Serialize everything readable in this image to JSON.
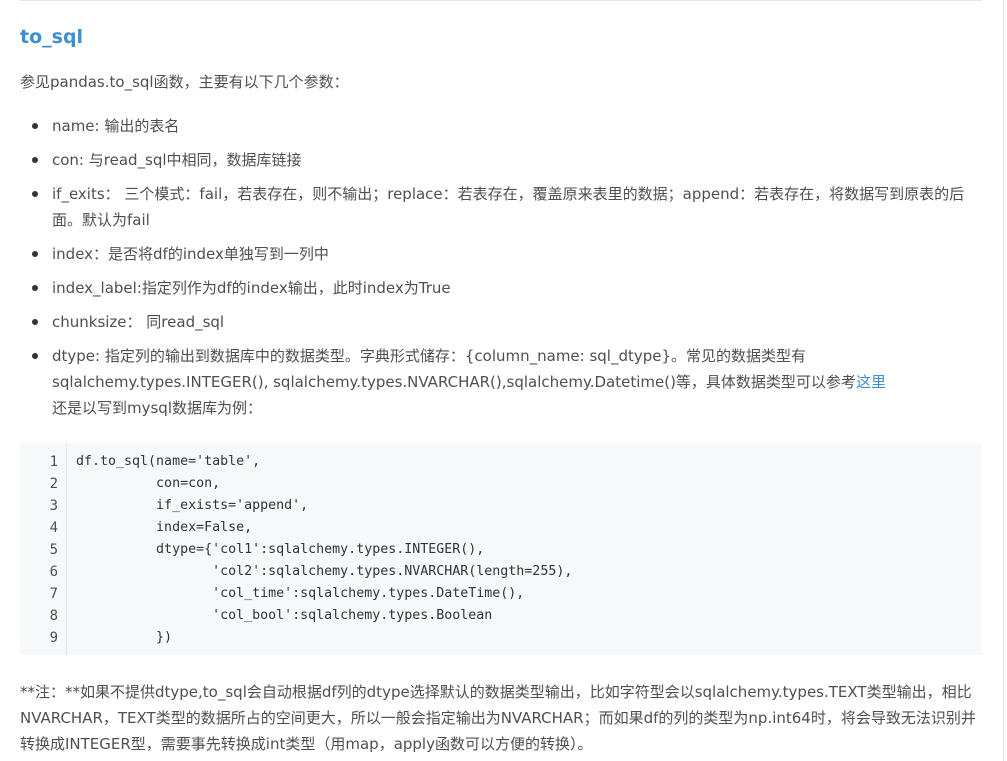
{
  "title": "to_sql",
  "intro": "参见pandas.to_sql函数，主要有以下几个参数：",
  "params": [
    {
      "text": "name: 输出的表名"
    },
    {
      "text": "con: 与read_sql中相同，数据库链接"
    },
    {
      "text": "if_exits： 三个模式：fail，若表存在，则不输出；replace：若表存在，覆盖原来表里的数据；append：若表存在，将数据写到原表的后面。默认为fail"
    },
    {
      "text": "index：是否将df的index单独写到一列中"
    },
    {
      "text": "index_label:指定列作为df的index输出，此时index为True"
    },
    {
      "text": "chunksize： 同read_sql"
    },
    {
      "text": "dtype: 指定列的输出到数据库中的数据类型。字典形式储存：{column_name: sql_dtype}。常见的数据类型有sqlalchemy.types.INTEGER(), sqlalchemy.types.NVARCHAR(),sqlalchemy.Datetime()等，具体数据类型可以参考",
      "link": "这里",
      "after": "还是以写到mysql数据库为例："
    }
  ],
  "code": {
    "line_numbers": [
      "1",
      "2",
      "3",
      "4",
      "5",
      "6",
      "7",
      "8",
      "9"
    ],
    "lines": [
      "df.to_sql(name='table',",
      "          con=con,",
      "          if_exists='append',",
      "          index=False,",
      "          dtype={'col1':sqlalchemy.types.INTEGER(),",
      "                 'col2':sqlalchemy.types.NVARCHAR(length=255),",
      "                 'col_time':sqlalchemy.types.DateTime(),",
      "                 'col_bool':sqlalchemy.types.Boolean",
      "          })"
    ]
  },
  "note": "**注：**如果不提供dtype,to_sql会自动根据df列的dtype选择默认的数据类型输出，比如字符型会以sqlalchemy.types.TEXT类型输出，相比NVARCHAR，TEXT类型的数据所占的空间更大，所以一般会指定输出为NVARCHAR；而如果df的列的类型为np.int64时，将会导致无法识别并转换成INTEGER型，需要事先转换成int类型（用map，apply函数可以方便的转换）。",
  "colors": {
    "title": "#3d8fd1",
    "link": "#3d8fd1",
    "text": "#4f4f4f",
    "code_bg": "#f6f8fa"
  }
}
